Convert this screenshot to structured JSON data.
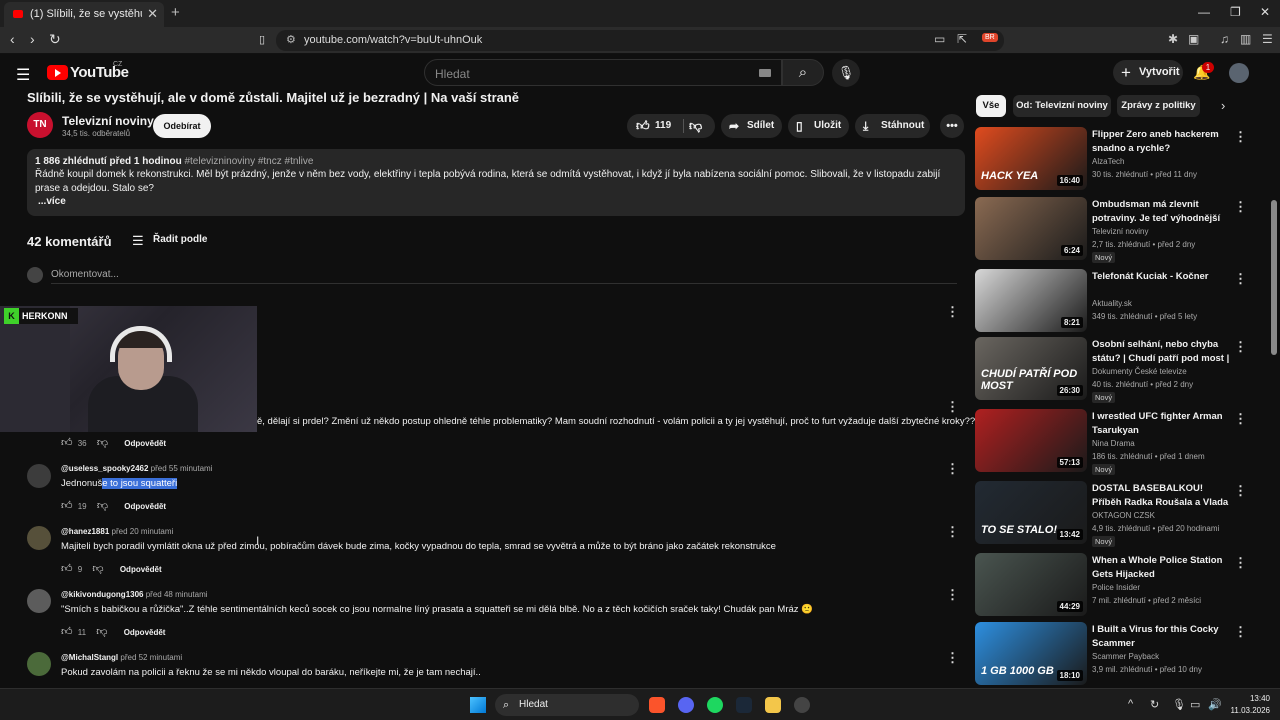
{
  "browser": {
    "tab_title": "(1) Slíbili, že se vystěhují, ale v d...",
    "tab_close": "✕",
    "new_tab": "+",
    "url": "youtube.com/watch?v=buUt-uhnOuk",
    "brave_badge": "BR"
  },
  "header": {
    "logo_text": "YouTube",
    "region": "CZ",
    "search_placeholder": "Hledat",
    "create_label": "Vytvořit",
    "notif_count": "1"
  },
  "video": {
    "title": "Slíbili, že se vystěhují, ale v domě zůstali. Majitel už je bezradný | Na vaší straně",
    "channel_logo": "TN",
    "channel": "Televizní noviny",
    "subscribers": "34,5 tis. odběratelů",
    "subscribe_label": "Odebírat",
    "likes": "119",
    "share_label": "Sdílet",
    "save_label": "Uložit",
    "download_label": "Stáhnout",
    "more": "•••"
  },
  "description": {
    "stats": "1 886 zhlédnutí  před 1 hodinou",
    "tags": "#televizninoviny #tncz #tnlive",
    "text": "Řádně koupil domek k rekonstrukci. Měl být prázdný, jenže v něm bez vody, elektřiny i tepla pobývá rodina, která se odmítá vystěhovat, i když jí byla nabízena sociální pomoc. Slibovali, že v listopadu zabijí prase a odejdou. Stalo se?",
    "more_label": "...více"
  },
  "comments_header": {
    "count": "42 komentářů",
    "sort_label": "Řadit podle",
    "input_placeholder": "Okomentovat..."
  },
  "overlay": {
    "brand_letter": "K",
    "brand": "HERKONN"
  },
  "comments": [
    {
      "text": "ě, dělají si prdel? Změní už někdo postup ohledně téhle problematiky? Mam soudní rozhodnutí - volám policii a ty jej vystěhují, proč to furt vyžaduje další zbytečné kroky??",
      "likes": "36",
      "reply": "Odpovědět"
    },
    {
      "user": "@useless_spooky2462",
      "time": "před 55 minutami",
      "text_pre": "Jednonuš",
      "text_hl": "e to jsou squatteři",
      "likes": "19",
      "reply": "Odpovědět"
    },
    {
      "user": "@hanez1881",
      "time": "před 20 minutami",
      "text": "Majiteli bych poradil vymlátit okna už před zimou, pobíračům dávek bude zima, kočky vypadnou do tepla, smrad se vyvětrá a může to být bráno jako začátek rekonstrukce",
      "likes": "9",
      "reply": "Odpovědět"
    },
    {
      "user": "@kikivondugong1306",
      "time": "před 48 minutami",
      "text": "\"Smích s babičkou a růžička\"..Z téhle sentimentálních keců socek co jsou normalne líný prasata a squatteři se mi dělá blbě. No a z těch kočičích sraček taky! Chudák pan Mráz 🙁",
      "likes": "11",
      "reply": "Odpovědět"
    },
    {
      "user": "@MichalStangl",
      "time": "před 52 minutami",
      "text": "Pokud zavolám na policii a řeknu že se mi někdo vloupal do baráku, neříkejte mi, že je tam nechají.."
    }
  ],
  "sidebar": {
    "chips": [
      "Vše",
      "Od: Televizní noviny",
      "Zprávy z politiky"
    ],
    "videos": [
      {
        "title": "Flipper Zero aneb hackerem snadno a rychle?",
        "channel": "AlzaTech",
        "views": "30 tis. zhlédnutí • před 11 dny",
        "duration": "16:40",
        "badge": "",
        "thumb_text": "HACK YEA",
        "color": "#e04b1e"
      },
      {
        "title": "Ombudsman má zlevnit potraviny. Je teď výhodnější ...",
        "channel": "Televizní noviny",
        "views": "2,7 tis. zhlédnutí • před 2 dny",
        "duration": "6:24",
        "badge": "Nový",
        "thumb_text": "",
        "color": "#8a6a52"
      },
      {
        "title": "Telefonát Kuciak - Kočner",
        "channel": "Aktuality.sk",
        "views": "349 tis. zhlédnutí • před 5 lety",
        "duration": "8:21",
        "badge": "",
        "thumb_text": "",
        "color": "#d8d8d8"
      },
      {
        "title": "Osobní selhání, nebo chyba státu? | Chudí patří pod most | ...",
        "channel": "Dokumenty České televize",
        "views": "40 tis. zhlédnutí • před 2 dny",
        "duration": "26:30",
        "badge": "Nový",
        "thumb_text": "CHUDÍ PATŘÍ POD MOST",
        "color": "#6a6660"
      },
      {
        "title": "I wrestled UFC fighter Arman Tsarukyan",
        "channel": "Nina Drama",
        "views": "186 tis. zhlédnutí • před 1 dnem",
        "duration": "57:13",
        "badge": "Nový",
        "thumb_text": "",
        "color": "#b02020"
      },
      {
        "title": "DOSTAL BASEBALKOU! Příběh Radka Roušala a Vlada Lengál...",
        "channel": "OKTAGON CZSK",
        "views": "4,9 tis. zhlédnutí • před 20 hodinami",
        "duration": "13:42",
        "badge": "Nový",
        "thumb_text": "TO SE STALO!",
        "color": "#222a33"
      },
      {
        "title": "When a Whole Police Station Gets Hijacked",
        "channel": "Police Insider",
        "views": "7 mil. zhlédnutí • před 2 měsíci",
        "duration": "44:29",
        "badge": "",
        "thumb_text": "",
        "color": "#4a5550"
      },
      {
        "title": "I Built a Virus for this Cocky Scammer",
        "channel": "Scammer Payback",
        "views": "3,9 mil. zhlédnutí • před 10 dny",
        "duration": "18:10",
        "badge": "",
        "thumb_text": "1 GB   1000 GB",
        "color": "#2d8fe0"
      }
    ]
  },
  "taskbar": {
    "search_label": "Hledat",
    "time": "13:40",
    "date": "11.03.2026"
  }
}
